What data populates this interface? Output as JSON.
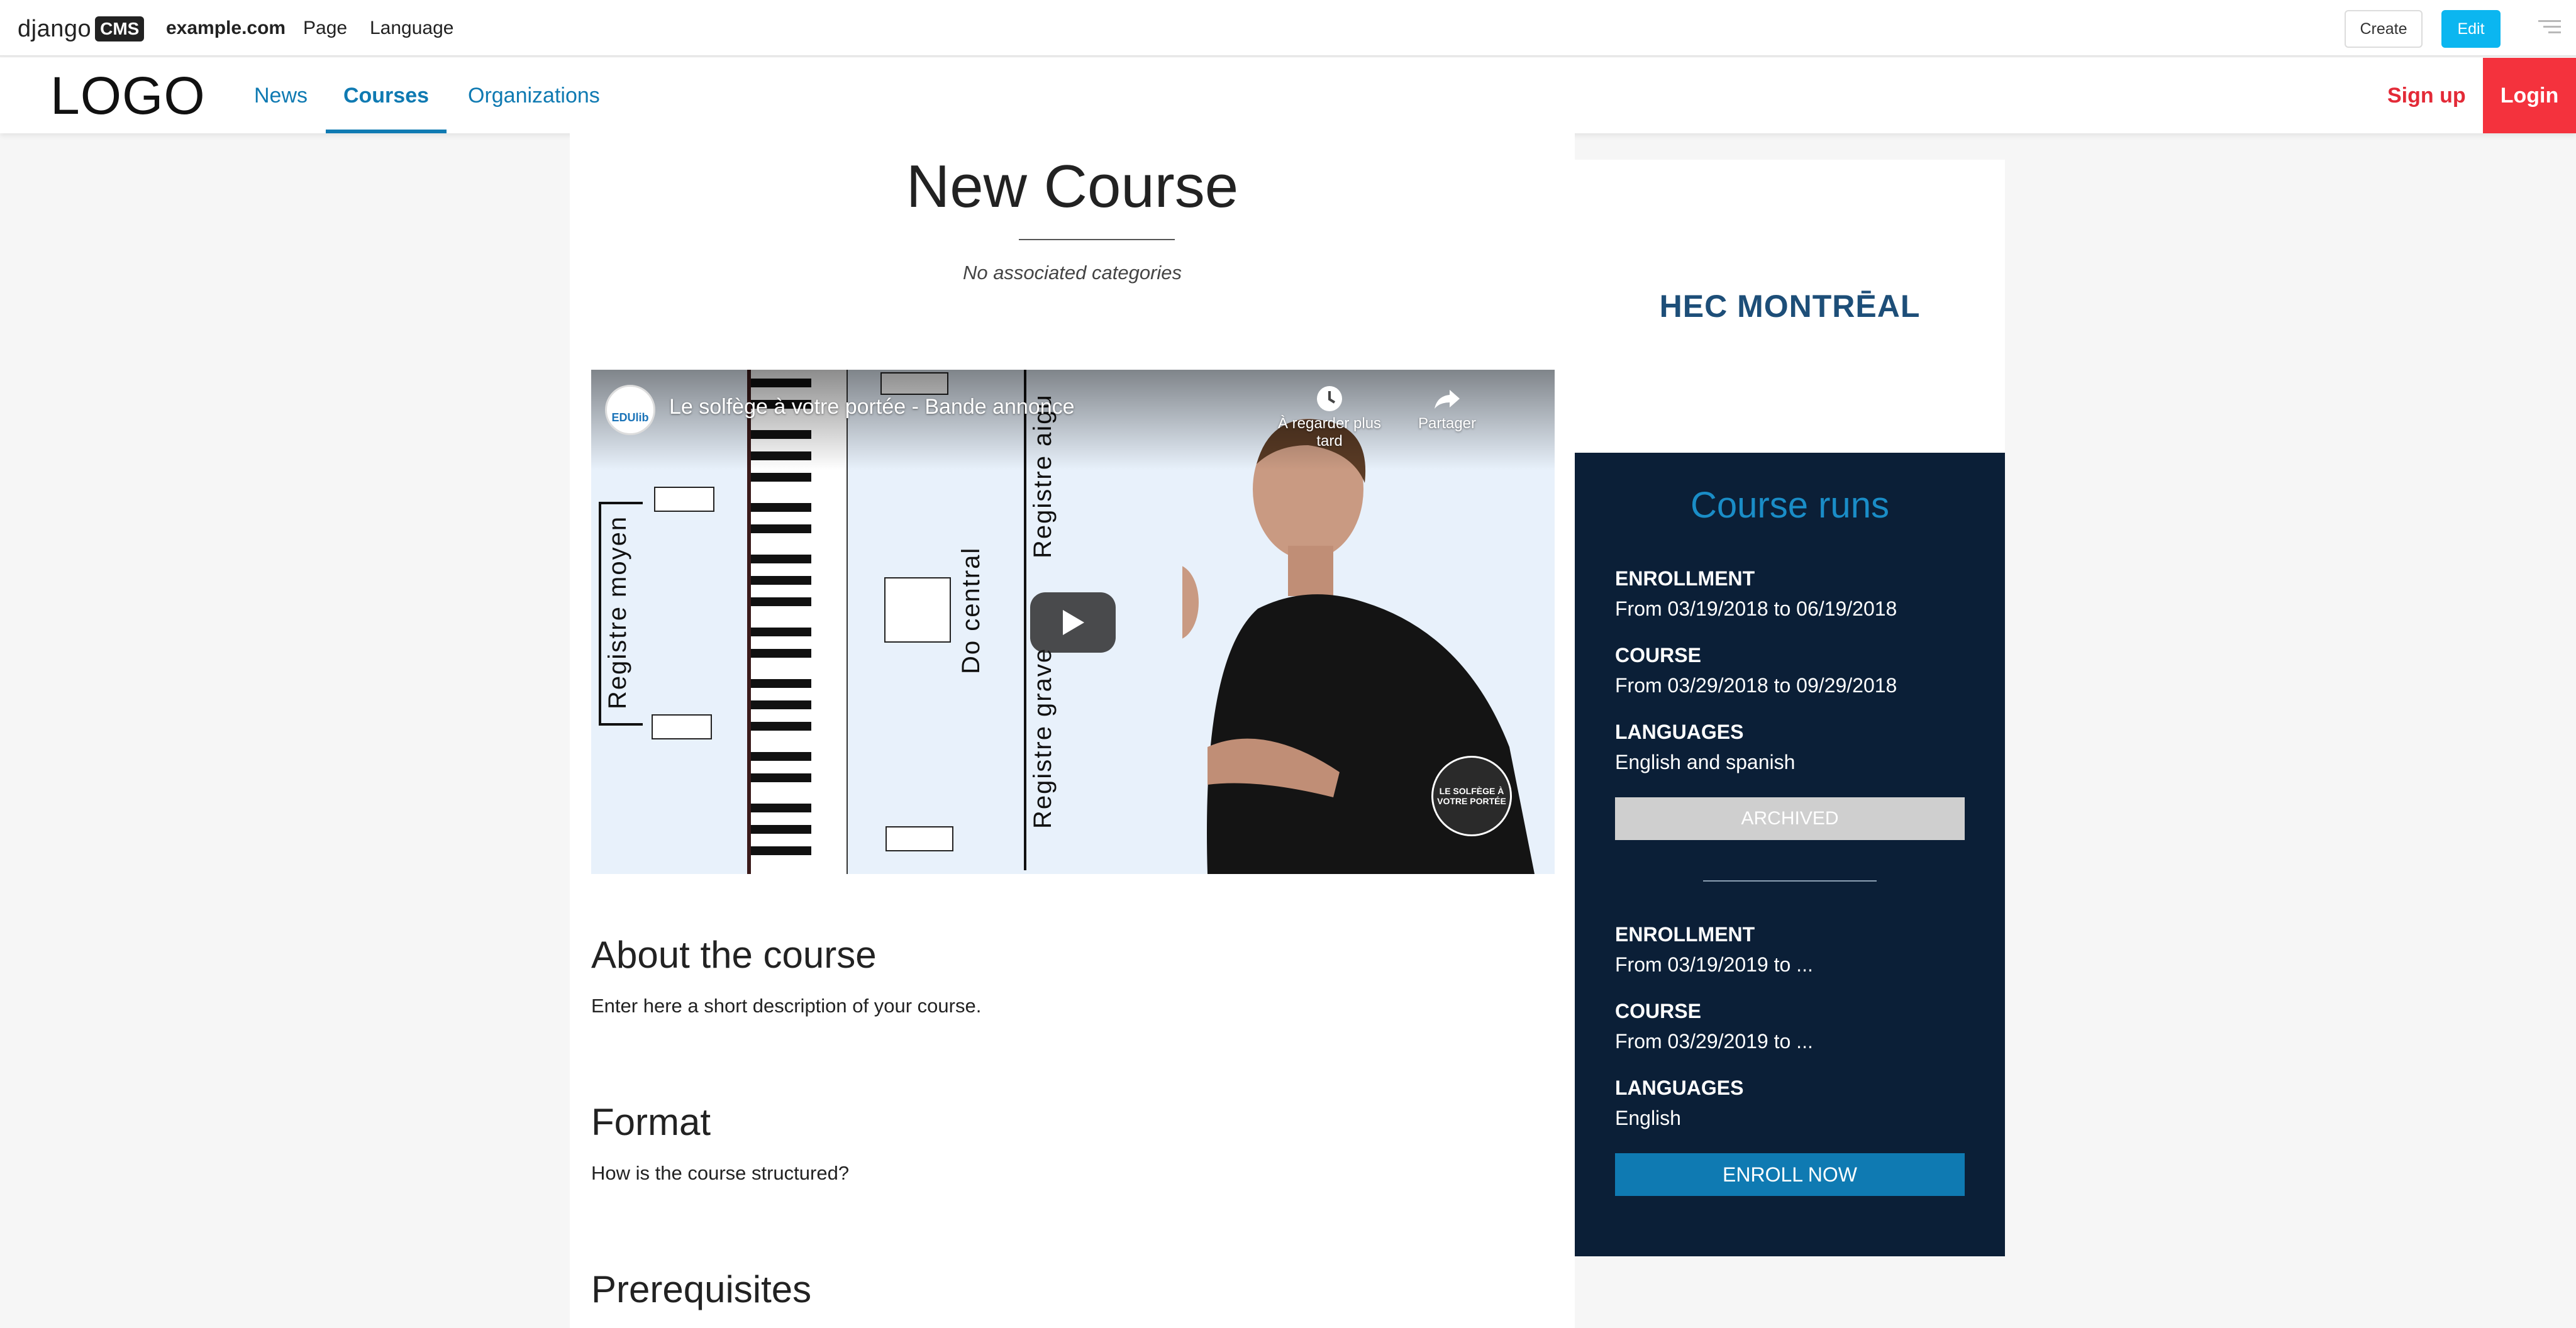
{
  "toolbar": {
    "logo_text": "django",
    "logo_badge": "CMS",
    "site": "example.com",
    "page_menu": "Page",
    "language_menu": "Language",
    "create_label": "Create",
    "edit_label": "Edit",
    "accent_color": "#0bb6f0"
  },
  "header": {
    "logo": "LOGO",
    "nav": [
      {
        "label": "News"
      },
      {
        "label": "Courses",
        "active": true
      },
      {
        "label": "Organizations"
      }
    ],
    "signup_label": "Sign up",
    "login_label": "Login",
    "brand_color": "#0f7ab2",
    "login_color": "#f4323d"
  },
  "course": {
    "title": "New Course",
    "categories": "No associated categories",
    "video": {
      "title": "Le solfège à votre portée - Bande annonce",
      "watch_later": "À regarder plus tard",
      "share": "Partager",
      "channel_badge": "EDUlib",
      "overlay_labels": [
        "Registre moyen",
        "Do central",
        "Registre aigu",
        "Registre grave"
      ],
      "corner_badge": "LE SOLFÈGE À VOTRE PORTÉE"
    },
    "sections": [
      {
        "title": "About the course",
        "text": "Enter here a short description of your course."
      },
      {
        "title": "Format",
        "text": "How is the course structured?"
      },
      {
        "title": "Prerequisites",
        "text": ""
      }
    ]
  },
  "organization": {
    "name": "HEC MONTRĒAL"
  },
  "course_runs": {
    "title": "Course runs",
    "runs": [
      {
        "enrollment_label": "ENROLLMENT",
        "enrollment_value": "From 03/19/2018 to 06/19/2018",
        "course_label": "COURSE",
        "course_value": "From 03/29/2018 to 09/29/2018",
        "languages_label": "LANGUAGES",
        "languages_value": "English and spanish",
        "action": "ARCHIVED"
      },
      {
        "enrollment_label": "ENROLLMENT",
        "enrollment_value": "From 03/19/2019 to ...",
        "course_label": "COURSE",
        "course_value": "From 03/29/2019 to ...",
        "languages_label": "LANGUAGES",
        "languages_value": "English",
        "action": "ENROLL NOW"
      }
    ],
    "panel_color": "#0b1f37"
  }
}
